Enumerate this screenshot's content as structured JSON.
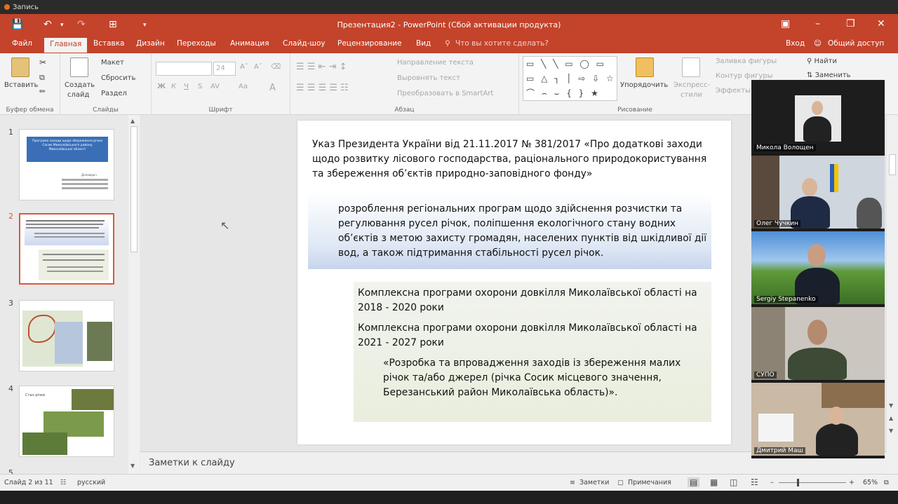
{
  "recorder": {
    "label": "Запись"
  },
  "window": {
    "title": "Презентация2 - PowerPoint (Сбой активации продукта)",
    "minimize": "–",
    "restore": "❐",
    "close": "✕",
    "ribbon_options": "▣"
  },
  "qat": {
    "save": "💾",
    "undo": "↶",
    "undo_drop": "▾",
    "redo": "↷",
    "present": "⊞",
    "customize": "▾"
  },
  "tabs": [
    "Файл",
    "Главная",
    "Вставка",
    "Дизайн",
    "Переходы",
    "Анимация",
    "Слайд-шоу",
    "Рецензирование",
    "Вид"
  ],
  "tell_me": "Что вы хотите сделать?",
  "account": {
    "signin": "Вход",
    "share": "Общий доступ"
  },
  "ribbon": {
    "clipboard": {
      "paste": "Вставить",
      "group": "Буфер обмена"
    },
    "slides": {
      "new_slide": "Создать",
      "new_slide2": "слайд",
      "layout": "Макет",
      "reset": "Сбросить",
      "section": "Раздел",
      "group": "Слайды"
    },
    "font": {
      "size": "24",
      "bold": "Ж",
      "italic": "К",
      "underline": "Ч",
      "strike": "S",
      "spacing": "AV",
      "case": "Aa",
      "color": "A",
      "group": "Шрифт"
    },
    "paragraph": {
      "direction": "Направление текста",
      "align": "Выровнять текст",
      "smartart": "Преобразовать в SmartArt",
      "group": "Абзац"
    },
    "drawing": {
      "shapes": "▭ ╲ ╲ ▭ ◯ ▭ ▭ △ ┐ │ ⇨ ⇩ ☆ ⌒ ⌢ ⌣ { } ★",
      "arrange": "Упорядочить",
      "quick_styles": "Экспресс-",
      "quick_styles2": "стили",
      "fill": "Заливка фигуры",
      "outline": "Контур фигуры",
      "effects": "Эффекты",
      "group": "Рисование"
    },
    "editing": {
      "find": "Найти",
      "replace": "Заменить"
    }
  },
  "thumbnails": [
    {
      "num": "1",
      "title": "Програма заходи щодо збереження річки Сосик Миколаївського району Миколаївської області",
      "sub": "Доповідач"
    },
    {
      "num": "2"
    },
    {
      "num": "3"
    },
    {
      "num": "4",
      "title": "Стан річки"
    },
    {
      "num": "5"
    }
  ],
  "slide": {
    "heading": "Указ Президента України від 21.11.2017 № 381/2017 «Про додаткові заходи щодо розвитку лісового господарства, раціонального природокористування та збереження об’єктів природно-заповідного фонду»",
    "bullet": "розроблення регіональних програм щодо здійснення розчистки та регулювання русел річок, поліпшення екологічного стану водних об’єктів з метою захисту громадян, населених пунктів від шкідливої дії вод, а також підтримання стабільності русел річок.",
    "prog1": "Комплексна програми охорони довкілля Миколаївської області на 2018 - 2020 роки",
    "prog2": "Комплексна програми охорони довкілля Миколаївської області на 2021 - 2027 роки",
    "quote": "«Розробка та впровадження заходів із збереження малих річок та/або джерел (річка Сосик місцевого значення, Березанський район Миколаївська область)»."
  },
  "notes": "Заметки к слайду",
  "status": {
    "slide": "Слайд 2 из 11",
    "lang": "русский",
    "notes": "Заметки",
    "comments": "Примечания",
    "zoom": "65%",
    "minus": "–",
    "plus": "+"
  },
  "participants": [
    {
      "name": "Микола Волощен"
    },
    {
      "name": "Олег Чучкин"
    },
    {
      "name": "Sergiy Stepanenko"
    },
    {
      "name": "СУПО"
    },
    {
      "name": "Дмитрий Маш"
    }
  ],
  "colors": {
    "accent": "#c4432b",
    "slide_box_blue": "#c6d5ec",
    "slide_box_green": "#e9eedd"
  }
}
